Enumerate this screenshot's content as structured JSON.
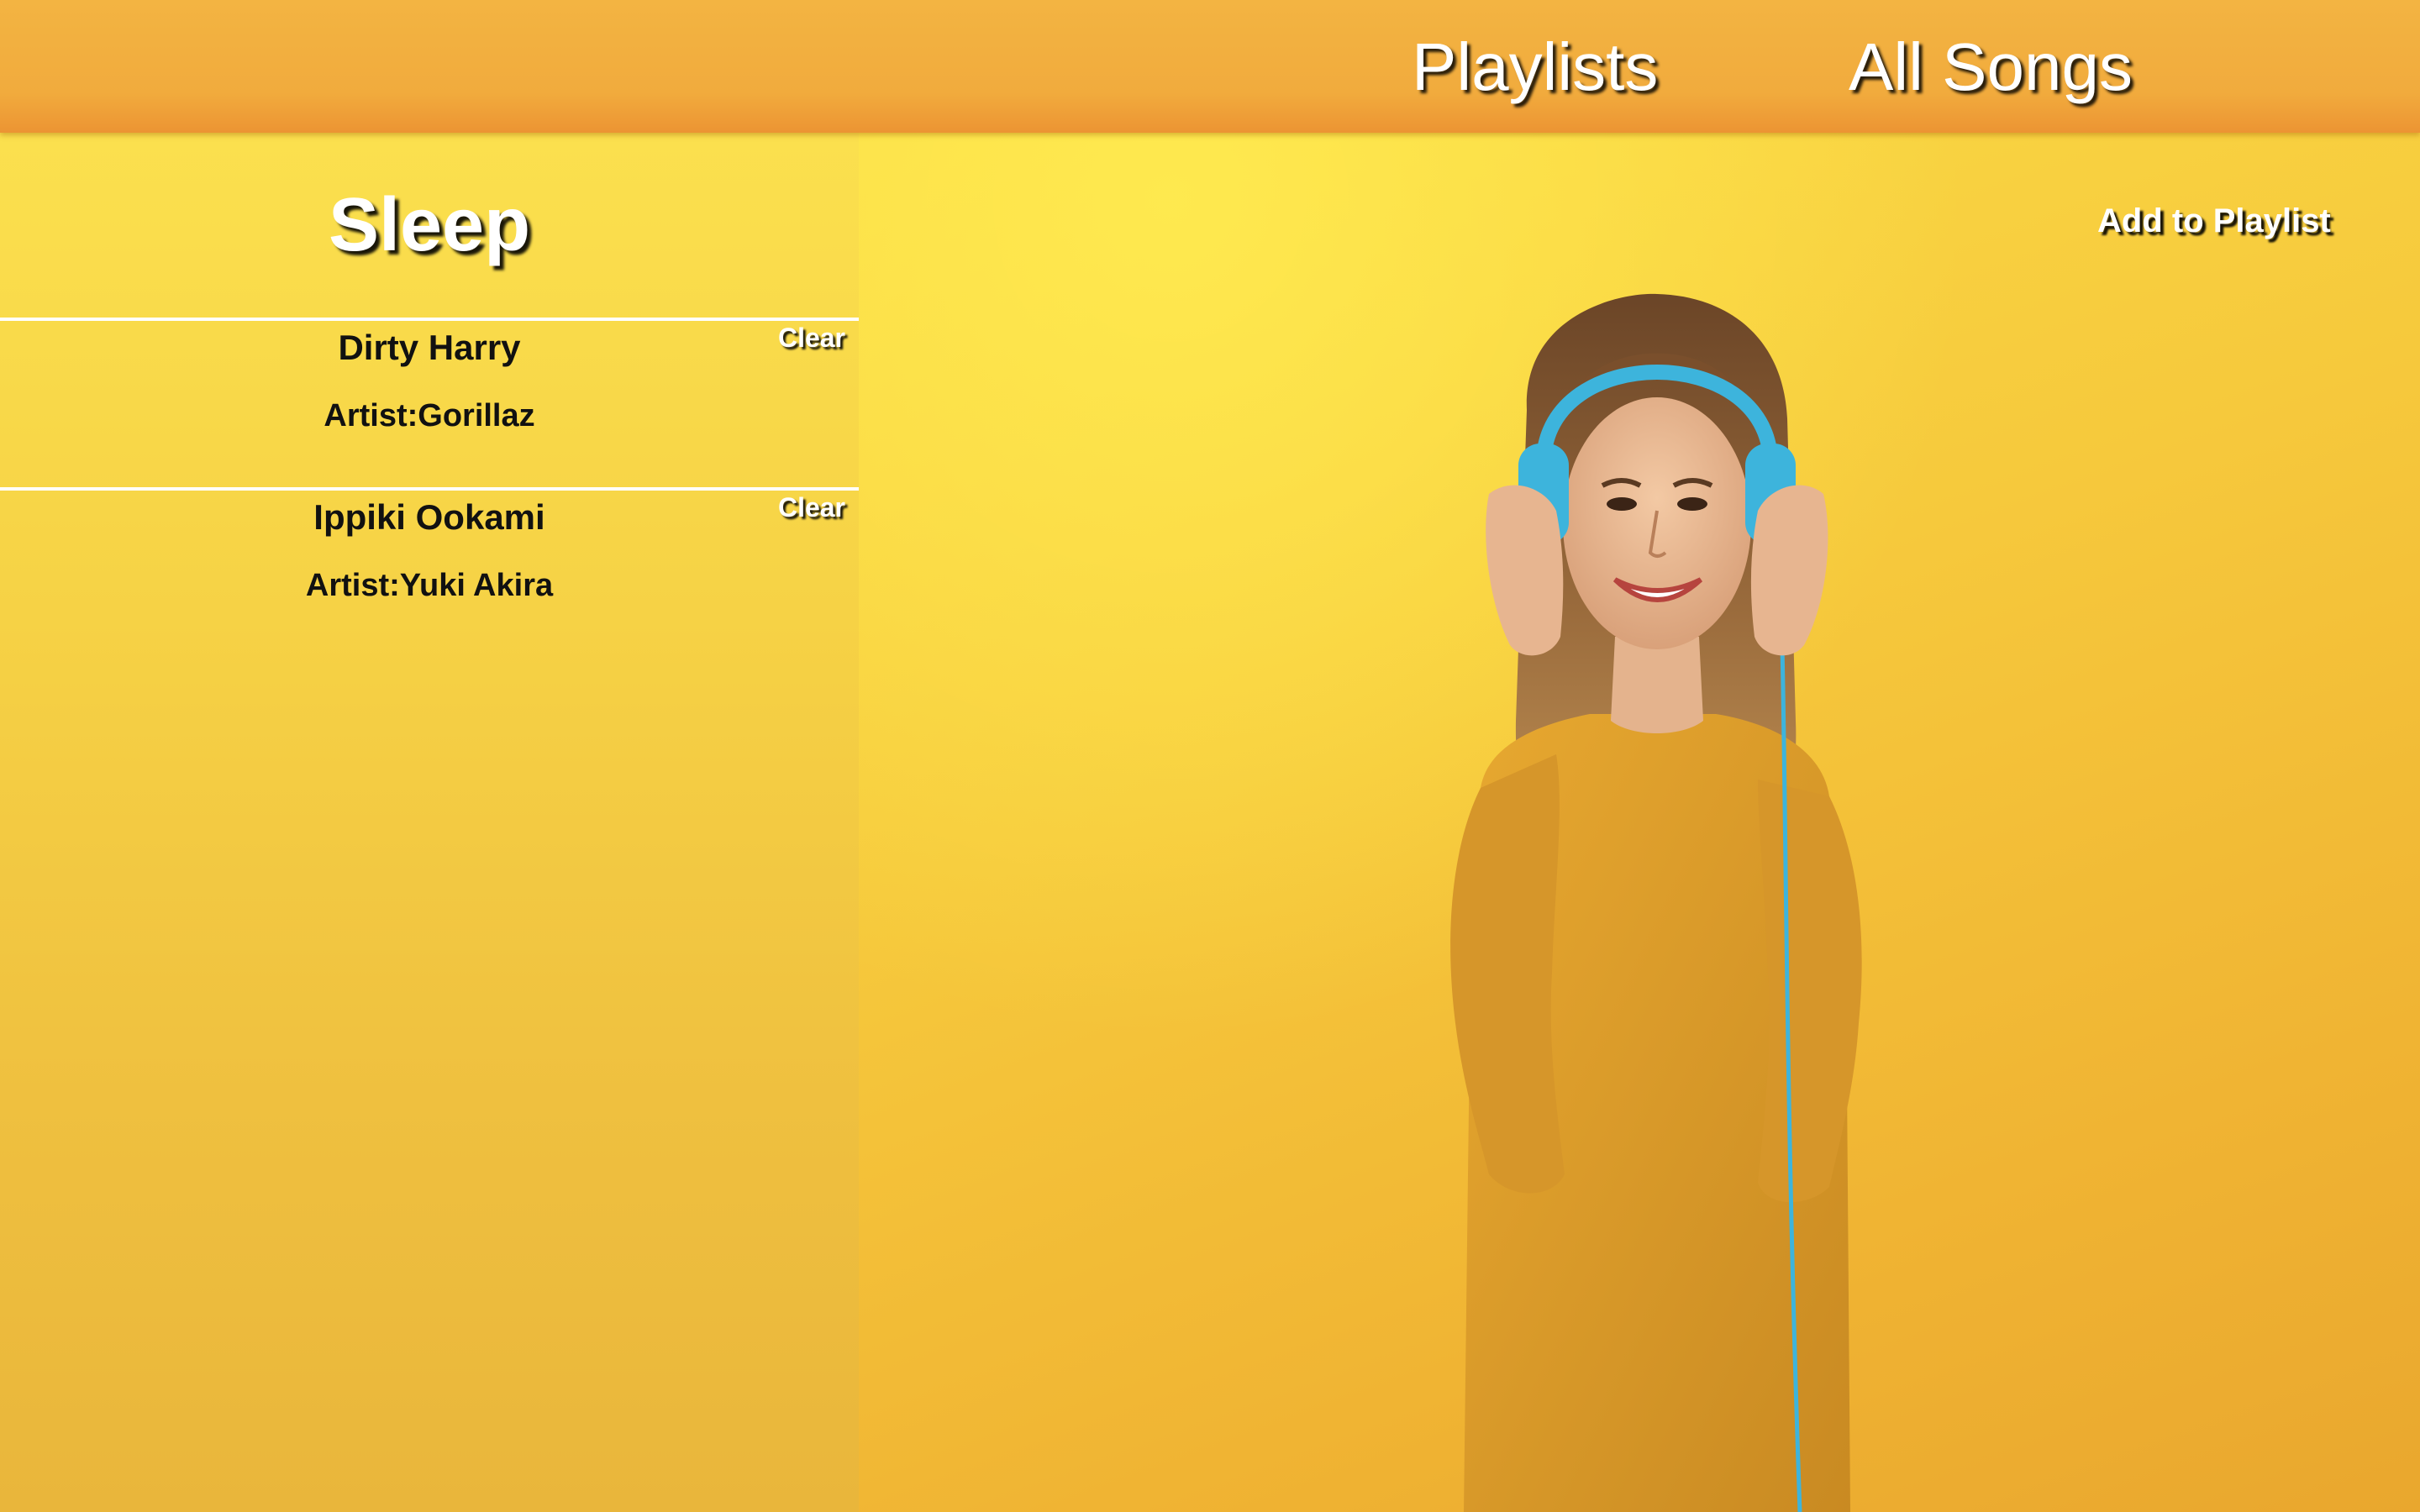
{
  "nav": {
    "playlists_label": "Playlists",
    "all_songs_label": "All Songs"
  },
  "playlist": {
    "title": "Sleep",
    "songs": [
      {
        "name": "Dirty Harry",
        "artist": "Artist:Gorillaz",
        "clear_label": "Clear"
      },
      {
        "name": "Ippiki Ookami",
        "artist": "Artist:Yuki Akira",
        "clear_label": "Clear"
      }
    ]
  },
  "hero": {
    "add_to_playlist_label": "Add to Playlist",
    "image_subject": "woman-with-headphones"
  },
  "colors": {
    "topbar": "#f1ab3d",
    "background_yellow": "#f6cf44",
    "headphones": "#3db4dc",
    "sweater": "#e0a02c",
    "divider": "#ffffff"
  }
}
